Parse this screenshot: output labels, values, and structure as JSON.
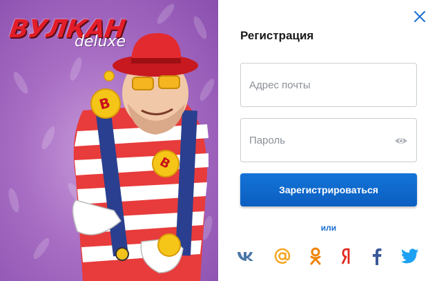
{
  "promo": {
    "logo_main": "ВУЛКАН",
    "logo_sub": "deluxe",
    "ball_letter": "В"
  },
  "form": {
    "title": "Регистрация",
    "email_placeholder": "Адрес почты",
    "password_placeholder": "Пароль",
    "submit_label": "Зарегистрироваться",
    "or_text": "или"
  },
  "social": [
    {
      "icon": "vk-icon",
      "color": "#4a76a8"
    },
    {
      "icon": "mail-at-icon",
      "color": "#f5a623"
    },
    {
      "icon": "odnoklassniki-icon",
      "color": "#ee8208"
    },
    {
      "icon": "yandex-icon",
      "color": "#e0271d"
    },
    {
      "icon": "facebook-icon",
      "color": "#3b5998"
    },
    {
      "icon": "twitter-icon",
      "color": "#1da1f2"
    }
  ],
  "colors": {
    "accent": "#1473d8",
    "close": "#1a6fd1",
    "promo_bg": "#a86ec4"
  }
}
